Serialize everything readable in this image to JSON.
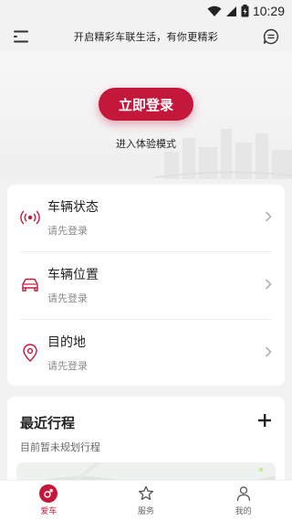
{
  "status_bar": {
    "time": "10:29"
  },
  "header": {
    "slogan": "开启精彩车联生活，有你更精彩"
  },
  "hero": {
    "login_label": "立即登录",
    "demo_label": "进入体验模式"
  },
  "vehicle_card": {
    "items": [
      {
        "title": "车辆状态",
        "subtitle": "请先登录",
        "icon": "signal-icon"
      },
      {
        "title": "车辆位置",
        "subtitle": "请先登录",
        "icon": "car-icon"
      },
      {
        "title": "目的地",
        "subtitle": "请先登录",
        "icon": "location-pin-icon"
      }
    ]
  },
  "trips": {
    "title": "最近行程",
    "subtitle": "目前暂未规划行程"
  },
  "tabbar": {
    "tabs": [
      {
        "label": "爱车",
        "icon": "car-tab-icon",
        "active": true
      },
      {
        "label": "服务",
        "icon": "star-icon",
        "active": false
      },
      {
        "label": "我的",
        "icon": "user-icon",
        "active": false
      }
    ]
  },
  "colors": {
    "accent": "#c3183a",
    "background": "#f2f2f2"
  }
}
